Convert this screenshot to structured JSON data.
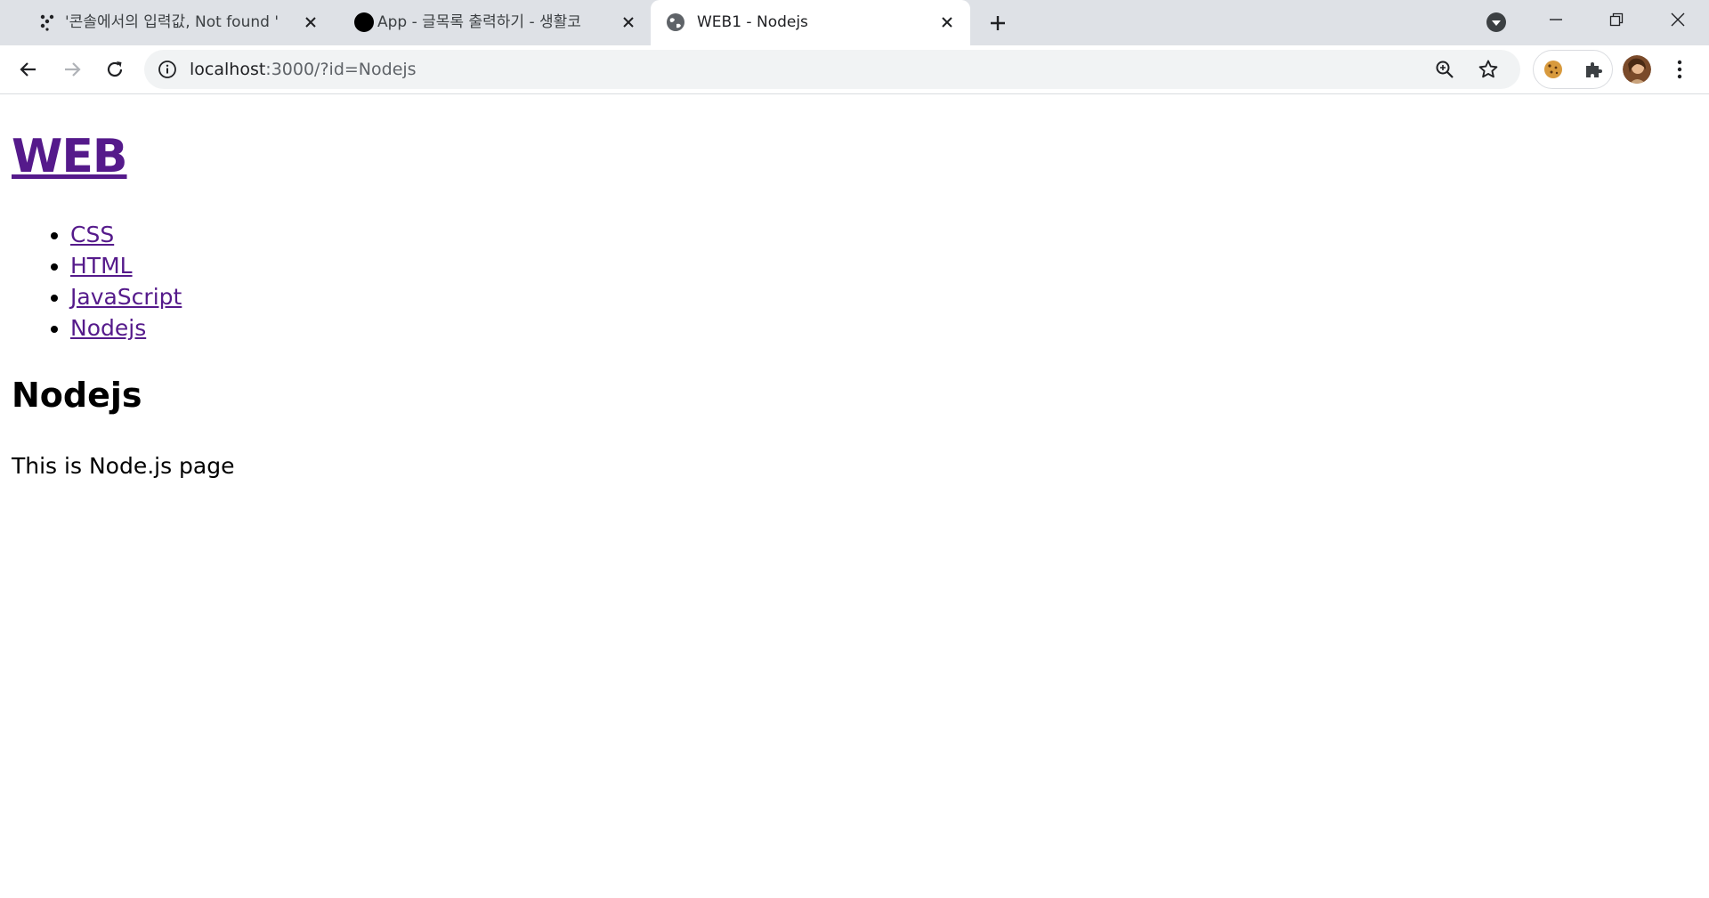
{
  "browser": {
    "tabs": [
      {
        "title": "'콘솔에서의 입력값, Not found '",
        "favicon": "dots-favicon",
        "active": false
      },
      {
        "title": "App - 글목록 출력하기 - 생활코",
        "favicon": "black-circle-favicon",
        "active": false
      },
      {
        "title": "WEB1 - Nodejs",
        "favicon": "globe-favicon",
        "active": true
      }
    ],
    "address": {
      "host": "localhost",
      "rest": ":3000/?id=Nodejs"
    }
  },
  "page": {
    "site_title": "WEB",
    "nav": [
      "CSS",
      "HTML",
      "JavaScript",
      "Nodejs"
    ],
    "heading": "Nodejs",
    "body": "This is Node.js page"
  },
  "colors": {
    "link": "#551a8b",
    "tabstrip": "#dee1e6",
    "omnibox": "#f1f3f4"
  }
}
